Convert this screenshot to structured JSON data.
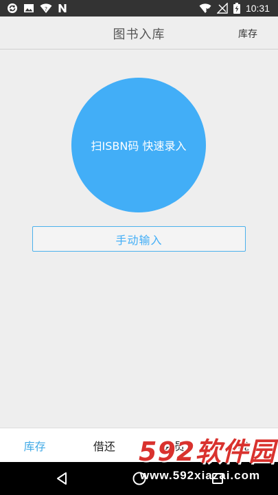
{
  "status_bar": {
    "time": "10:31",
    "icons_left": [
      "sync-icon",
      "image-icon",
      "wifi-unknown-icon",
      "n-icon"
    ],
    "icons_right": [
      "wifi-x-icon",
      "signal-off-icon",
      "battery-charging-icon"
    ]
  },
  "header": {
    "title": "图书入库",
    "action_label": "库存"
  },
  "scan": {
    "label": "扫ISBN码 快速录入",
    "color": "#42aef7"
  },
  "manual": {
    "label": "手动输入"
  },
  "bottom_nav": {
    "items": [
      {
        "label": "库存",
        "active": true
      },
      {
        "label": "借还",
        "active": false
      },
      {
        "label": "会员",
        "active": false
      },
      {
        "label": "我",
        "active": false
      }
    ],
    "active_color": "#3fa9e6"
  },
  "system_nav": {
    "buttons": [
      "back-icon",
      "home-icon",
      "recents-icon"
    ]
  },
  "watermark": {
    "brand": "592软件园",
    "url": "www.592xiazai.com"
  }
}
